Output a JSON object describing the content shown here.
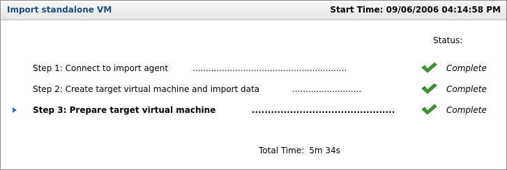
{
  "header": {
    "title": "Import standalone VM",
    "start_time": "Start Time: 09/06/2006  04:14:58 PM"
  },
  "status_label": "Status:",
  "steps": [
    {
      "text": "Step 1: Connect to import agent",
      "dots": "..........................................................",
      "status": "Complete"
    },
    {
      "text": "Step 2: Create target virtual machine and import data",
      "dots": "..........................",
      "status": "Complete"
    },
    {
      "text": "Step 3: Prepare target virtual machine",
      "dots": "...................................................................",
      "status": "Complete"
    }
  ],
  "current_step_index": 2,
  "total": {
    "label": "Total Time:",
    "value": "5m 34s"
  },
  "colors": {
    "title": "#1f4f7f",
    "check": "#3c9a2e",
    "arrow": "#2a6fc9"
  },
  "icons": {
    "status_complete": "checkmark-icon",
    "current_step": "current-step-arrow-icon"
  }
}
